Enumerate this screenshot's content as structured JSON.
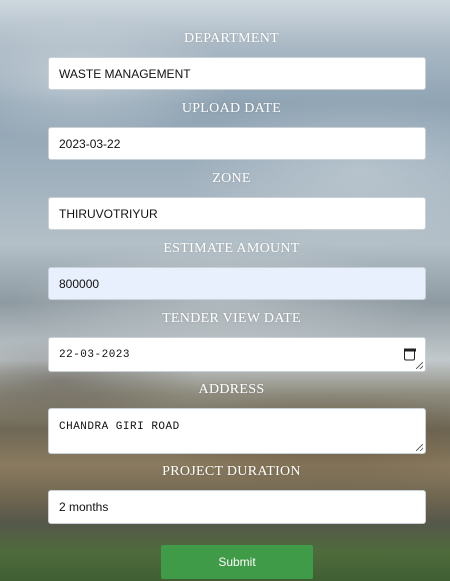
{
  "form": {
    "fields": [
      {
        "label": "DEPARTMENT",
        "value": "WASTE MANAGEMENT"
      },
      {
        "label": "UPLOAD DATE",
        "value": "2023-03-22"
      },
      {
        "label": "ZONE",
        "value": "THIRUVOTRIYUR"
      },
      {
        "label": "ESTIMATE AMOUNT",
        "value": "800000"
      },
      {
        "label": "TENDER VIEW DATE",
        "value": "22-03-2023"
      },
      {
        "label": "ADDRESS",
        "value": "CHANDRA GIRI ROAD"
      },
      {
        "label": "PROJECT DURATION",
        "value": "2 months"
      }
    ],
    "submit_label": "Submit"
  }
}
